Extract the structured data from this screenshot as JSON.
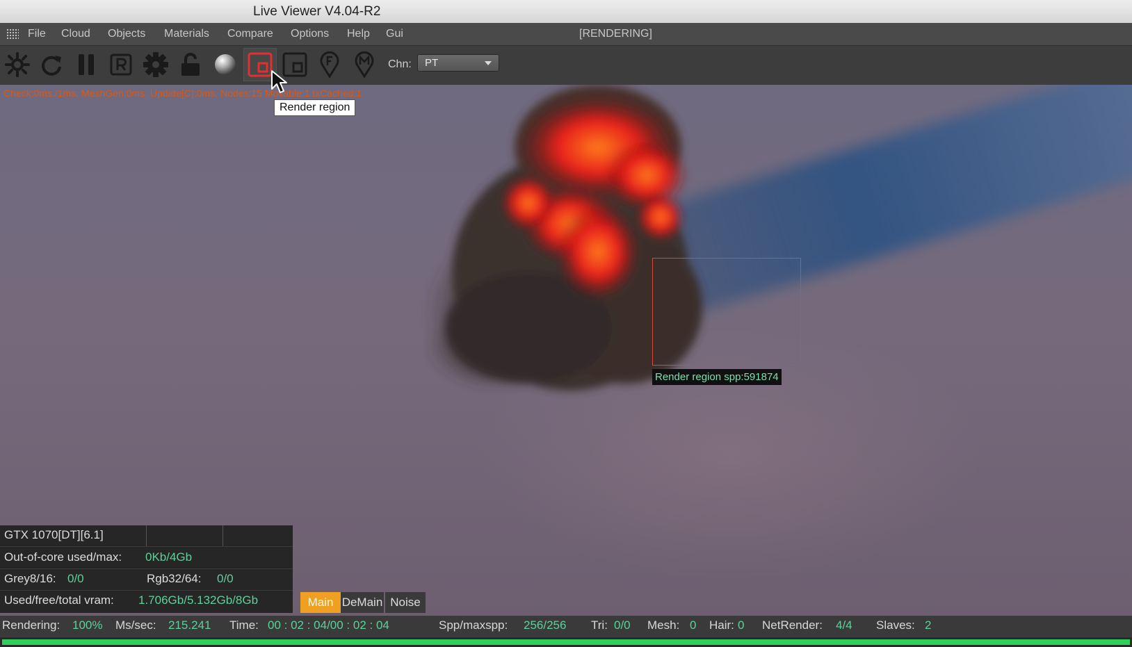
{
  "window": {
    "title": "Live Viewer V4.04-R2"
  },
  "menubar": {
    "items": [
      "File",
      "Cloud",
      "Objects",
      "Materials",
      "Compare",
      "Options",
      "Help",
      "Gui"
    ],
    "status": "[RENDERING]"
  },
  "toolbar": {
    "buttons": [
      {
        "icon": "settings-sun-icon"
      },
      {
        "icon": "refresh-icon"
      },
      {
        "icon": "pause-icon"
      },
      {
        "icon": "r-box-icon"
      },
      {
        "icon": "gear-icon"
      },
      {
        "icon": "lock-icon"
      },
      {
        "icon": "sphere-icon"
      },
      {
        "icon": "render-region-icon",
        "active": true
      },
      {
        "icon": "film-region-icon"
      },
      {
        "icon": "focus-pin-icon"
      },
      {
        "icon": "material-pin-icon"
      }
    ],
    "channel_label": "Chn:",
    "channel_value": "PT"
  },
  "viewport": {
    "debug_text": "Check:0ms./1ms. MeshGen:0ms. Update[C]:0ms. Nodes:15 Movable:1 txCached:1",
    "tooltip": "Render region",
    "region_label": "Render region spp:591874",
    "colors": {
      "region_border": "#d84a38",
      "accent_green": "#5fd09a",
      "active_tab": "#f0a020"
    }
  },
  "gpu_panel": {
    "device": "GTX 1070[DT][6.1]",
    "ooc_label": "Out-of-core used/max:",
    "ooc_value": "0Kb/4Gb",
    "grey_label": "Grey8/16:",
    "grey_value": "0/0",
    "rgb_label": "Rgb32/64:",
    "rgb_value": "0/0",
    "vram_label": "Used/free/total vram:",
    "vram_value": "1.706Gb/5.132Gb/8Gb"
  },
  "pass_tabs": [
    {
      "label": "Main",
      "active": true
    },
    {
      "label": "DeMain",
      "active": false
    },
    {
      "label": "Noise",
      "active": false
    }
  ],
  "statusbar": {
    "rendering_label": "Rendering:",
    "rendering_value": "100%",
    "mssec_label": "Ms/sec:",
    "mssec_value": "215.241",
    "time_label": "Time:",
    "time_value": "00 : 02 : 04/00 : 02 : 04",
    "spp_label": "Spp/maxspp:",
    "spp_value": "256/256",
    "tri_label": "Tri:",
    "tri_value": "0/0",
    "mesh_label": "Mesh:",
    "mesh_value": "0",
    "hair_label": "Hair:",
    "hair_value": "0",
    "net_label": "NetRender:",
    "net_value": "4/4",
    "slaves_label": "Slaves:",
    "slaves_value": "2"
  },
  "progress": {
    "fraction": 1.0
  }
}
